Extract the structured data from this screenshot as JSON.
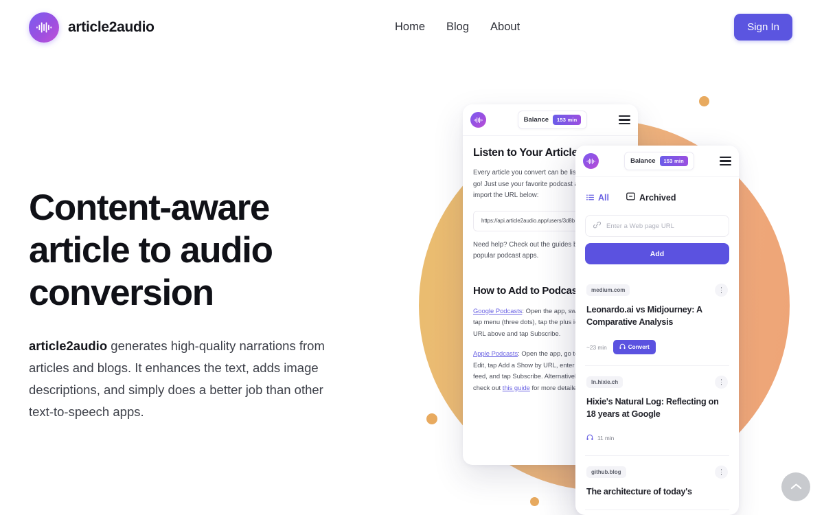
{
  "header": {
    "brand_name": "article2audio",
    "nav": [
      {
        "label": "Home"
      },
      {
        "label": "Blog"
      },
      {
        "label": "About"
      }
    ],
    "signin_label": "Sign In"
  },
  "hero": {
    "title": "Content-aware article to audio conversion",
    "sub_bold": "article2audio",
    "sub_rest": " generates high-quality narrations from articles and blogs. It enhances the text, adds image descriptions, and simply does a better job than other text-to-speech apps."
  },
  "mock_back": {
    "balance_label": "Balance",
    "balance_value": "153 min",
    "heading": "Listen to Your Articles",
    "intro_line1": "Every article you convert can be liste",
    "intro_line2": "go! Just use your favorite podcast ap",
    "intro_line3": "import the URL below:",
    "feed_url": "https://api.article2audio.app/users/3d8b",
    "help_line1": "Need help? Check out the guides be",
    "help_line2": "popular podcast apps.",
    "heading2": "How to Add to Podcas",
    "guides": [
      {
        "link": "Google Podcasts",
        "l1": ": Open the app, swi",
        "l2": "tap menu (three dots), tap the plus ic",
        "l3": "URL above and tap Subscribe."
      },
      {
        "link": "Apple Podcasts",
        "l1": ": Open the app, go to",
        "l2": "Edit, tap Add a Show by URL, enter y",
        "l3": "feed, and tap Subscribe. Alternatively",
        "l4_pre": "check out ",
        "l4_link": "this guide",
        "l4_post": " for more detailed"
      }
    ]
  },
  "mock_front": {
    "balance_label": "Balance",
    "balance_value": "153 min",
    "tabs": [
      {
        "label": "All",
        "icon": "list-icon",
        "state": "active"
      },
      {
        "label": "Archived",
        "icon": "archive-icon",
        "state": "idle"
      }
    ],
    "url_placeholder": "Enter a Web page URL",
    "add_label": "Add",
    "cards": [
      {
        "source": "medium.com",
        "title": "Leonardo.ai vs Midjourney: A Comparative Analysis",
        "duration": "~23 min",
        "action_label": "Convert",
        "has_action": true
      },
      {
        "source": "ln.hixie.ch",
        "title": "Hixie's Natural Log: Reflecting on 18 years at Google",
        "duration": "11 min",
        "has_action": false
      },
      {
        "source": "github.blog",
        "title": "The architecture of today's",
        "has_action": false
      }
    ]
  },
  "scroll_top": {
    "label": "chevron-up-icon"
  },
  "colors": {
    "accent_indigo": "#5b52e0",
    "brand_purple": "#7b5cf0",
    "brand_magenta": "#c050d8",
    "decor_gold": "#e9bd6d",
    "decor_peach": "#eda476",
    "dot": "#e8aa5f"
  }
}
